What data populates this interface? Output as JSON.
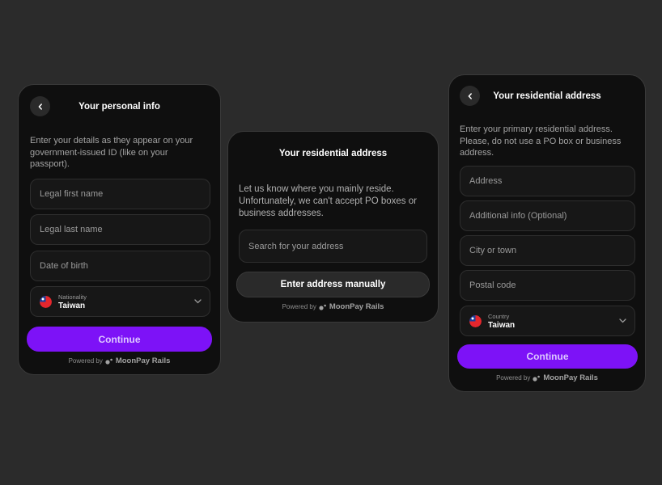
{
  "personal_info": {
    "title": "Your personal info",
    "description": "Enter your details as they appear on your government-issued ID (like on your passport).",
    "fields": {
      "first_name": "Legal first name",
      "last_name": "Legal last name",
      "dob": "Date of birth"
    },
    "nationality": {
      "label": "Nationality",
      "value": "Taiwan"
    },
    "continue_label": "Continue",
    "powered_by": "Powered by",
    "brand": "MoonPay Rails"
  },
  "address_search": {
    "title": "Your residential address",
    "description": "Let us know where you mainly reside. Unfortunately, we can't accept PO boxes or business addresses.",
    "search_placeholder": "Search for your address",
    "manual_label": "Enter address manually",
    "powered_by": "Powered by",
    "brand": "MoonPay Rails"
  },
  "address_form": {
    "title": "Your residential address",
    "description": "Enter your primary residential address. Please, do not use a PO box or business address.",
    "fields": {
      "address": "Address",
      "additional": "Additional info (Optional)",
      "city": "City or town",
      "postal": "Postal code"
    },
    "country": {
      "label": "Country",
      "value": "Taiwan"
    },
    "continue_label": "Continue",
    "powered_by": "Powered by",
    "brand": "MoonPay Rails"
  },
  "colors": {
    "page_bg": "#2b2b2b",
    "card_bg": "#0f0f0f",
    "accent": "#7d12f7",
    "field_bg": "#171717"
  },
  "icons": [
    "back-arrow-icon",
    "chevron-down-icon",
    "taiwan-flag-icon",
    "moonpay-logo-icon"
  ]
}
